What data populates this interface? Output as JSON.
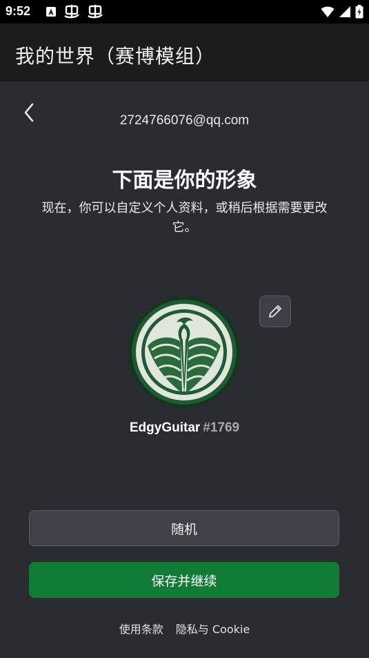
{
  "status_bar": {
    "time": "9:52",
    "icons_left": [
      "a-notification-icon",
      "bug-icon",
      "bug-icon"
    ],
    "icons_right": [
      "wifi-icon",
      "signal-icon",
      "battery-charging-icon"
    ]
  },
  "app_bar": {
    "title": "我的世界（赛博模组）"
  },
  "account": {
    "email": "2724766076@qq.com"
  },
  "profile": {
    "heading": "下面是你的形象",
    "subtext": "现在，你可以自定义个人资料，或稍后根据需要更改它。",
    "gamertag_name": "EdgyGuitar",
    "gamertag_suffix": "#1769",
    "avatar_icon": "phoenix-emblem-icon"
  },
  "actions": {
    "random_label": "随机",
    "save_label": "保存并继续"
  },
  "footer": {
    "terms_label": "使用条款",
    "privacy_label": "隐私与 Cookie"
  },
  "colors": {
    "background": "#2a2c31",
    "app_bar": "#1c1c1d",
    "accent_green": "#107c36",
    "avatar_ring": "#1b4d2a",
    "avatar_inner": "#1f5a32"
  }
}
